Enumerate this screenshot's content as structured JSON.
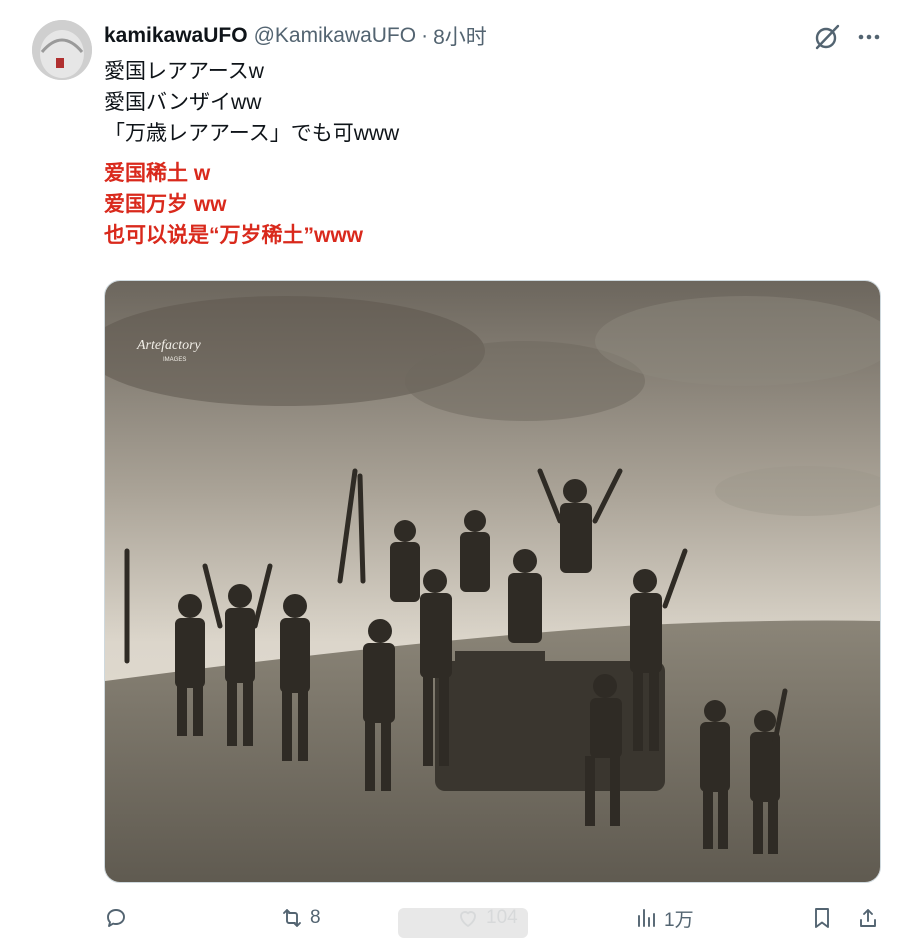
{
  "author": {
    "name": "kamikawaUFO",
    "handle": "@KamikawaUFO",
    "separator": "·",
    "time": "8小时"
  },
  "tweet_lines": [
    "愛国レアアースw",
    "愛国バンザイww",
    "「万歳レアアース」でも可www"
  ],
  "translation_lines": [
    "爱国稀土 w",
    "爱国万岁 ww",
    "也可以说是“万岁稀土”www"
  ],
  "media": {
    "watermark_title": "Artefactory",
    "watermark_sub": "IMAGES"
  },
  "actions": {
    "reply": {
      "icon": "reply-icon",
      "count": ""
    },
    "retweet": {
      "icon": "retweet-icon",
      "count": "8"
    },
    "like": {
      "icon": "heart-icon",
      "count": "104"
    },
    "views": {
      "icon": "views-icon",
      "count": "1万"
    },
    "bookmark": {
      "icon": "bookmark-icon"
    },
    "share": {
      "icon": "share-icon"
    }
  },
  "colors": {
    "text": "#0f1419",
    "secondary": "#536471",
    "translation_red": "#d9291c"
  }
}
